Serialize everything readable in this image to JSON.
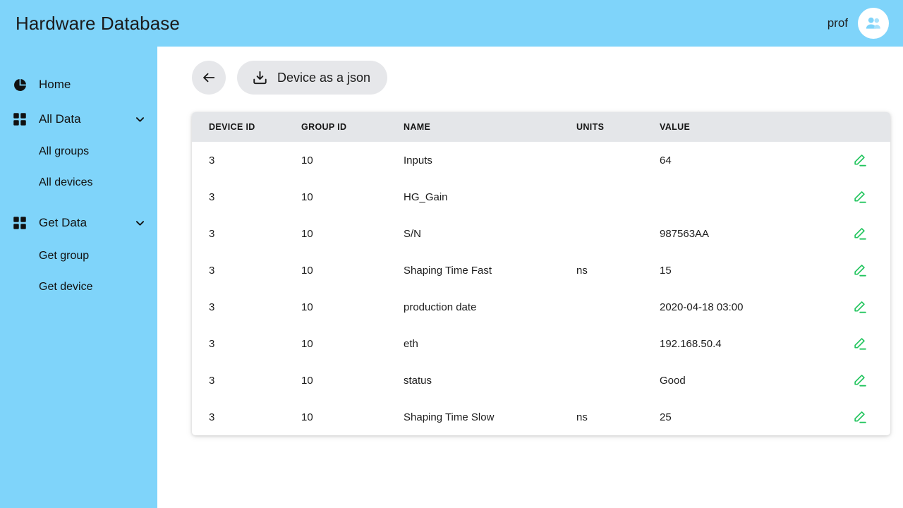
{
  "header": {
    "title": "Hardware Database",
    "user": "prof",
    "avatar_icon": "users-icon"
  },
  "sidebar": {
    "items": [
      {
        "label": "Home",
        "icon": "pie-chart-icon",
        "type": "link"
      },
      {
        "label": "All Data",
        "icon": "grid-icon",
        "type": "group",
        "chevron": "chevron-down-icon"
      },
      {
        "label": "All groups",
        "type": "sub"
      },
      {
        "label": "All devices",
        "type": "sub"
      },
      {
        "label": "Get Data",
        "icon": "grid-icon",
        "type": "group",
        "chevron": "chevron-down-icon"
      },
      {
        "label": "Get group",
        "type": "sub"
      },
      {
        "label": "Get device",
        "type": "sub"
      }
    ]
  },
  "toolbar": {
    "back_icon": "arrow-left-icon",
    "json_label": "Device as a json",
    "json_icon": "download-icon"
  },
  "table": {
    "columns": [
      "DEVICE ID",
      "GROUP ID",
      "NAME",
      "UNITS",
      "VALUE",
      ""
    ],
    "row_action_icon": "pencil-edit-icon",
    "rows": [
      {
        "device_id": "3",
        "group_id": "10",
        "name": "Inputs",
        "units": "",
        "value": "64"
      },
      {
        "device_id": "3",
        "group_id": "10",
        "name": "HG_Gain",
        "units": "",
        "value": ""
      },
      {
        "device_id": "3",
        "group_id": "10",
        "name": "S/N",
        "units": "",
        "value": "987563AA"
      },
      {
        "device_id": "3",
        "group_id": "10",
        "name": "Shaping Time Fast",
        "units": "ns",
        "value": "15"
      },
      {
        "device_id": "3",
        "group_id": "10",
        "name": "production date",
        "units": "",
        "value": "2020-04-18 03:00"
      },
      {
        "device_id": "3",
        "group_id": "10",
        "name": "eth",
        "units": "",
        "value": "192.168.50.4"
      },
      {
        "device_id": "3",
        "group_id": "10",
        "name": "status",
        "units": "",
        "value": "Good"
      },
      {
        "device_id": "3",
        "group_id": "10",
        "name": "Shaping Time Slow",
        "units": "ns",
        "value": "25"
      }
    ]
  },
  "colors": {
    "brand_blue": "#7FD4FA",
    "table_header_bg": "#E4E6E9",
    "button_bg": "#E6E7EA",
    "edit_green": "#22C55E",
    "page_bg": "#FFFFFF"
  }
}
